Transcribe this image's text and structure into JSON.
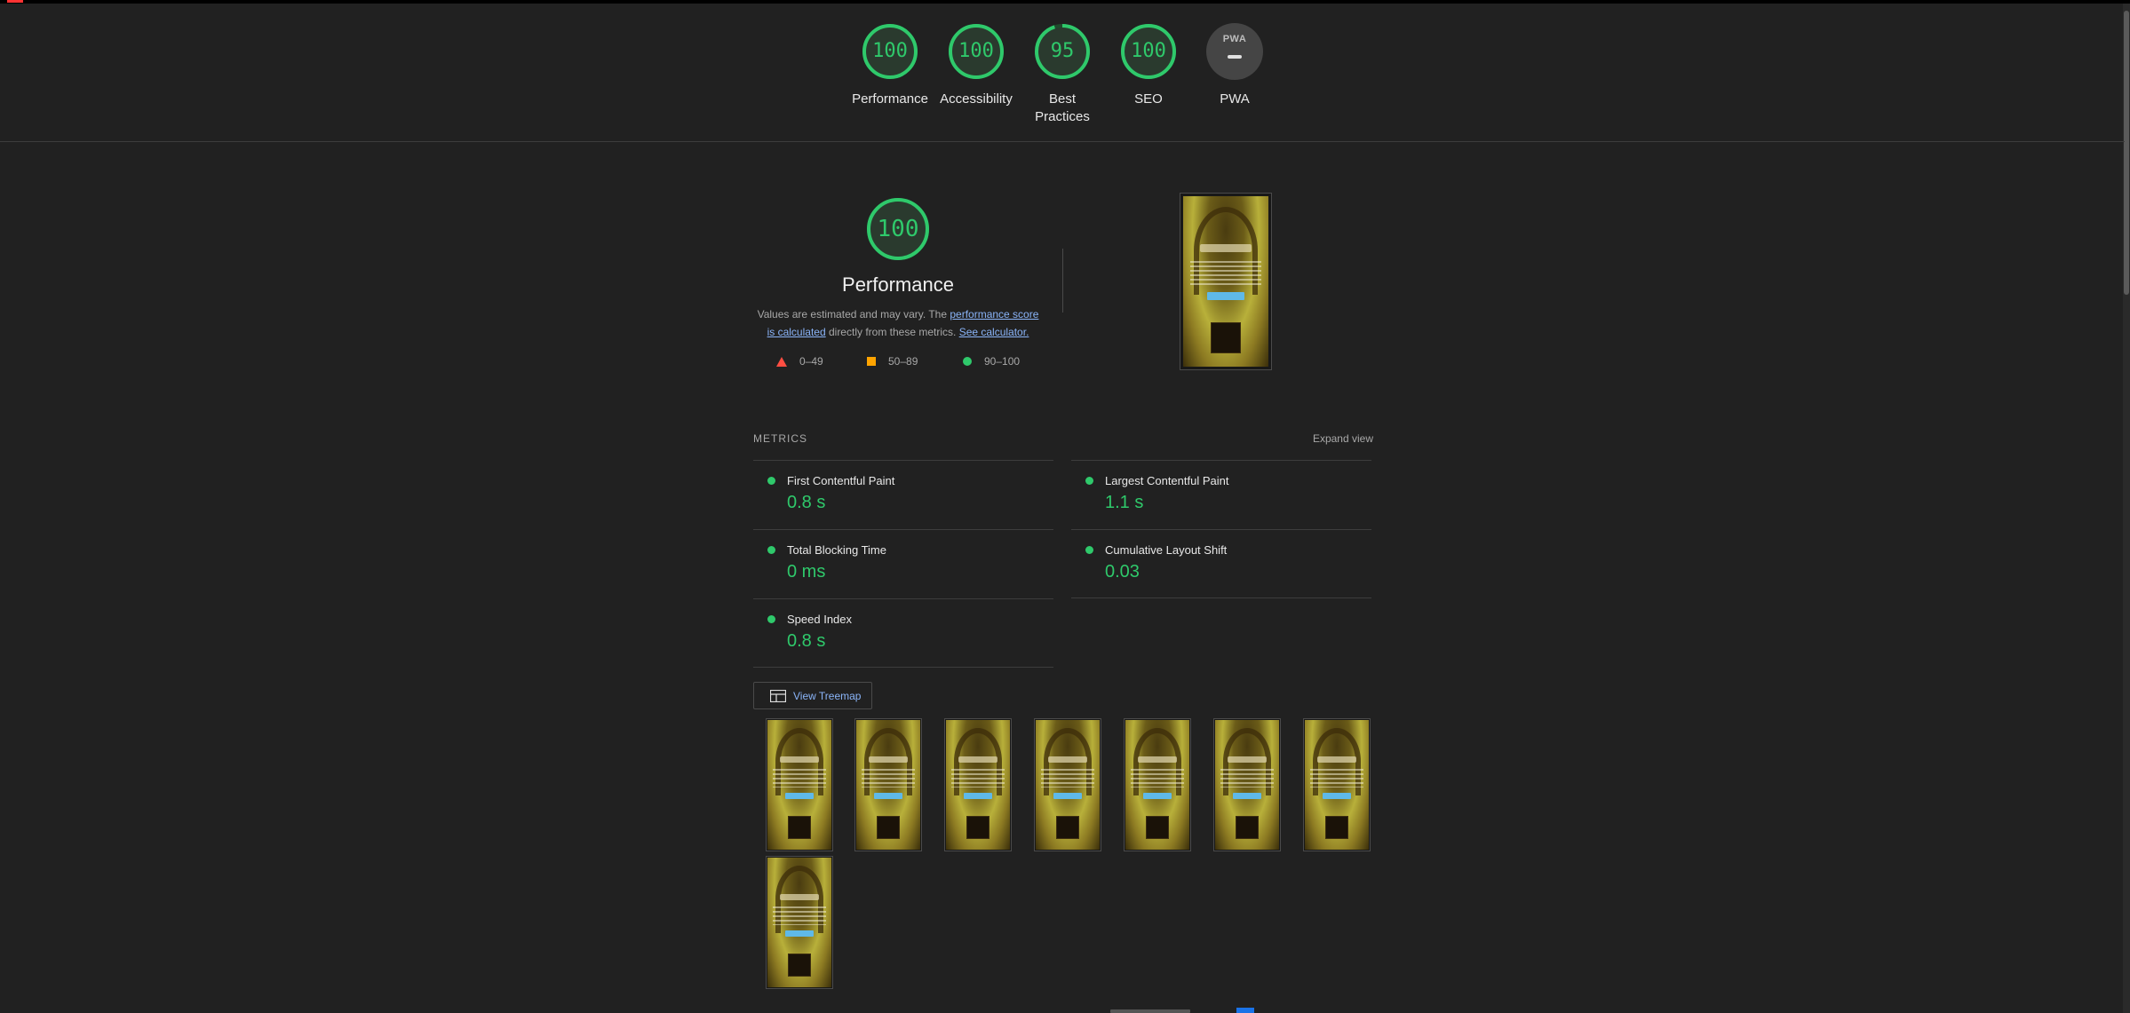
{
  "header": {
    "gauges": [
      {
        "label": "Performance",
        "score": "100",
        "fraction": 1.0
      },
      {
        "label": "Accessibility",
        "score": "100",
        "fraction": 1.0
      },
      {
        "label": "Best Practices",
        "score": "95",
        "fraction": 0.95
      },
      {
        "label": "SEO",
        "score": "100",
        "fraction": 1.0
      }
    ],
    "pwa": {
      "label": "PWA",
      "badge_text": "PWA"
    }
  },
  "performance": {
    "score": "100",
    "fraction": 1.0,
    "title": "Performance",
    "desc_prefix": "Values are estimated and may vary. The ",
    "desc_link1": "performance score is calculated",
    "desc_middle": " directly from these metrics. ",
    "desc_link2": "See calculator.",
    "legend": [
      {
        "shape": "triangle",
        "label": "0–49",
        "color": "#ff4e42"
      },
      {
        "shape": "square",
        "label": "50–89",
        "color": "#ffa400"
      },
      {
        "shape": "circle",
        "label": "90–100",
        "color": "#2fc96b"
      }
    ]
  },
  "metrics": {
    "title": "METRICS",
    "expand_label": "Expand view",
    "items": [
      {
        "name": "First Contentful Paint",
        "value": "0.8 s"
      },
      {
        "name": "Largest Contentful Paint",
        "value": "1.1 s"
      },
      {
        "name": "Total Blocking Time",
        "value": "0 ms"
      },
      {
        "name": "Cumulative Layout Shift",
        "value": "0.03"
      },
      {
        "name": "Speed Index",
        "value": "0.8 s"
      }
    ]
  },
  "treemap": {
    "label": "View Treemap"
  },
  "filmstrip": {
    "frame_count": 8
  },
  "colors": {
    "pass": "#2fc96b",
    "average": "#ffa400",
    "fail": "#ff4e42",
    "link": "#8ab4f8",
    "background": "#212121"
  }
}
